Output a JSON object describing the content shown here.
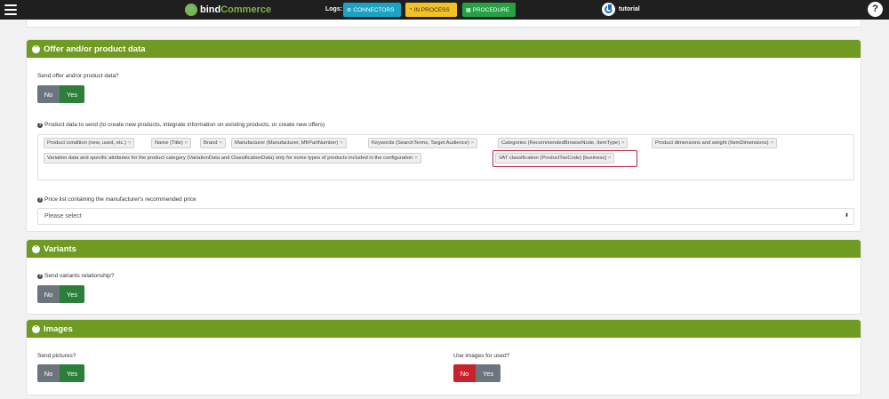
{
  "topbar": {
    "brand_a": "bind",
    "brand_b": "Commerce",
    "logs_label": "Logs:",
    "connectors": "CONNECTORS",
    "in_process": "IN PROCESS",
    "procedure": "PROCEDURE",
    "user": "tutorial",
    "help": "?"
  },
  "offer": {
    "title": "Offer and/or product data",
    "send_label": "Send offer and/or product data?",
    "no": "No",
    "yes": "Yes",
    "product_data_label": "Product data to send (to create new products, integrate information on existing products, or create new offers)",
    "tags": [
      "Product condition (new, used, etc.)",
      "Name (Title)",
      "Brand",
      "Manufacturer (Manufacturer, MfrPartNumber)",
      "Keywords (SearchTerms, Target Audience)",
      "Categories (RecommendedBrowseNode, ItemType)",
      "Product dimensions and weight (ItemDimensions)",
      "Variation data and specific attributes for the product category (VariationData and ClassificationData) only for some types of products included in the configuration",
      "VAT classification (ProductTaxCode) [business]"
    ],
    "tag_remove": "×",
    "price_list_label": "Price list containing the manufacturer's recommended price",
    "price_list_placeholder": "Please select"
  },
  "variants": {
    "title": "Variants",
    "send_label": "Send variants relationship?",
    "no": "No",
    "yes": "Yes"
  },
  "images": {
    "title": "Images",
    "send_label": "Send pictures?",
    "no": "No",
    "yes": "Yes",
    "used_label": "Use images for used?",
    "used_no": "No",
    "used_yes": "Yes"
  },
  "colors": {
    "topbar": "#1f1f1f",
    "panel_header": "#6f9b22",
    "yes_active": "#2c7f3a",
    "no_active": "#c8232c",
    "inactive": "#6c757d",
    "highlight": "#c0224a"
  }
}
